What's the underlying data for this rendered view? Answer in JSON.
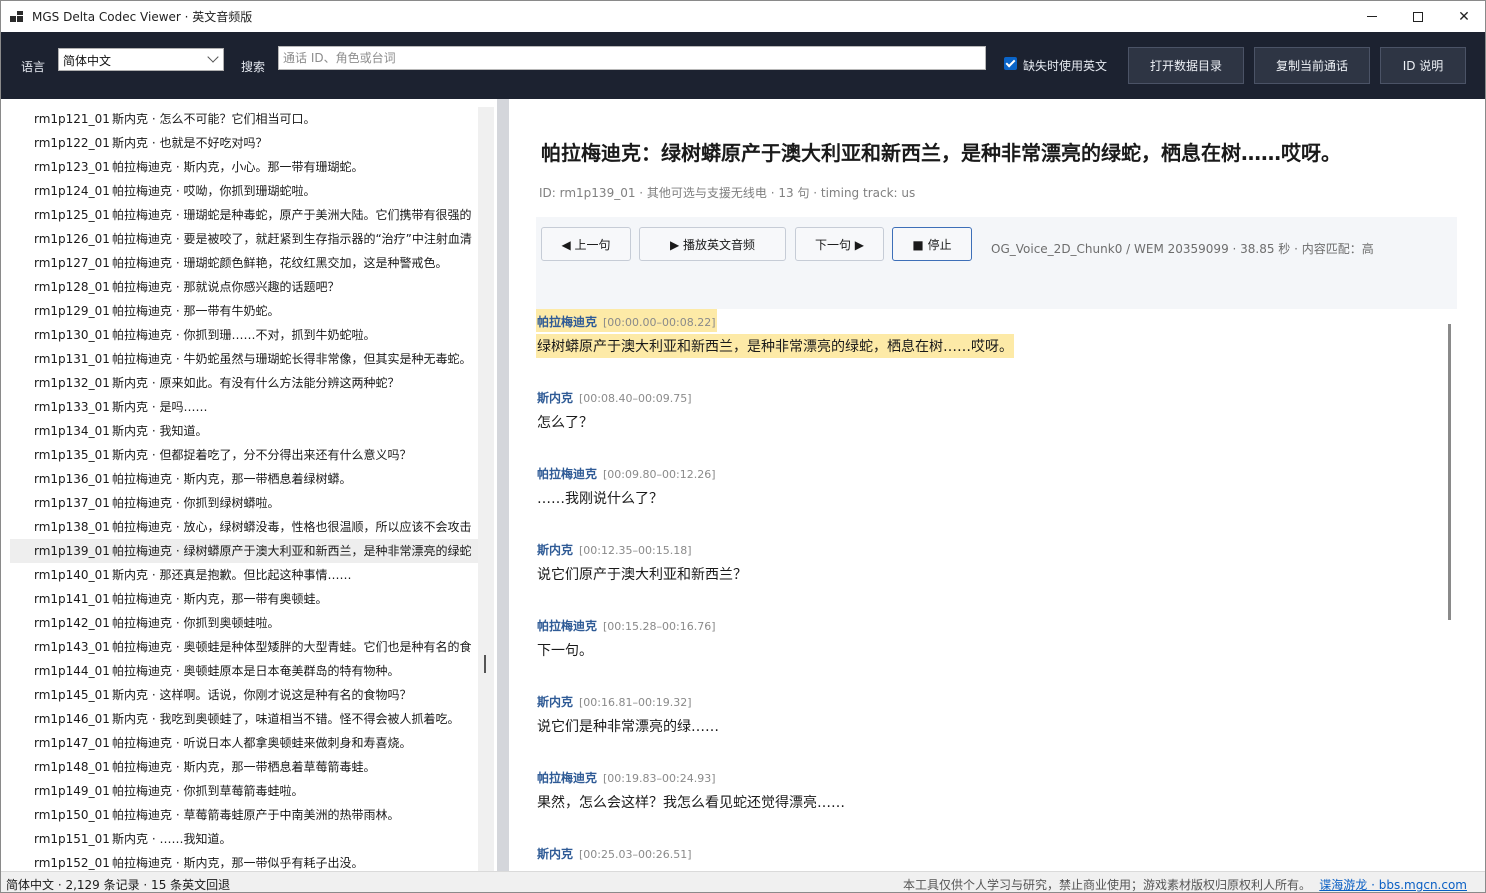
{
  "window": {
    "title": "MGS Delta Codec Viewer · 英文音频版"
  },
  "toolbar": {
    "language_label": "语言",
    "language_value": "简体中文",
    "search_label": "搜索",
    "search_placeholder": "通话 ID、角色或台词",
    "search_value": "",
    "fallback_checked": true,
    "fallback_label": "缺失时使用英文",
    "open_data_label": "打开数据目录",
    "copy_call_label": "复制当前通话",
    "id_help_label": "ID 说明"
  },
  "call_list": {
    "selected_index": 18,
    "items": [
      {
        "id": "rm1p121_01",
        "text": "斯内克 · 怎么不可能？它们相当可口。"
      },
      {
        "id": "rm1p122_01",
        "text": "斯内克 · 也就是不好吃对吗？"
      },
      {
        "id": "rm1p123_01",
        "text": "帕拉梅迪克 · 斯内克，小心。那一带有珊瑚蛇。"
      },
      {
        "id": "rm1p124_01",
        "text": "帕拉梅迪克 · 哎呦，你抓到珊瑚蛇啦。"
      },
      {
        "id": "rm1p125_01",
        "text": "帕拉梅迪克 · 珊瑚蛇是种毒蛇，原产于美洲大陆。它们携带有很强的"
      },
      {
        "id": "rm1p126_01",
        "text": "帕拉梅迪克 · 要是被咬了，就赶紧到生存指示器的“治疗”中注射血清"
      },
      {
        "id": "rm1p127_01",
        "text": "帕拉梅迪克 · 珊瑚蛇颜色鲜艳，花纹红黑交加，这是种警戒色。"
      },
      {
        "id": "rm1p128_01",
        "text": "帕拉梅迪克 · 那就说点你感兴趣的话题吧？"
      },
      {
        "id": "rm1p129_01",
        "text": "帕拉梅迪克 · 那一带有牛奶蛇。"
      },
      {
        "id": "rm1p130_01",
        "text": "帕拉梅迪克 · 你抓到珊……不对，抓到牛奶蛇啦。"
      },
      {
        "id": "rm1p131_01",
        "text": "帕拉梅迪克 · 牛奶蛇虽然与珊瑚蛇长得非常像，但其实是种无毒蛇。"
      },
      {
        "id": "rm1p132_01",
        "text": "斯内克 · 原来如此。有没有什么方法能分辨这两种蛇？"
      },
      {
        "id": "rm1p133_01",
        "text": "斯内克 · 是吗……"
      },
      {
        "id": "rm1p134_01",
        "text": "斯内克 · 我知道。"
      },
      {
        "id": "rm1p135_01",
        "text": "斯内克 · 但都捉着吃了，分不分得出来还有什么意义吗？"
      },
      {
        "id": "rm1p136_01",
        "text": "帕拉梅迪克 · 斯内克，那一带栖息着绿树蟒。"
      },
      {
        "id": "rm1p137_01",
        "text": "帕拉梅迪克 · 你抓到绿树蟒啦。"
      },
      {
        "id": "rm1p138_01",
        "text": "帕拉梅迪克 · 放心，绿树蟒没毒，性格也很温顺，所以应该不会攻击"
      },
      {
        "id": "rm1p139_01",
        "text": "帕拉梅迪克 · 绿树蟒原产于澳大利亚和新西兰，是种非常漂亮的绿蛇"
      },
      {
        "id": "rm1p140_01",
        "text": "斯内克 · 那还真是抱歉。但比起这种事情……"
      },
      {
        "id": "rm1p141_01",
        "text": "帕拉梅迪克 · 斯内克，那一带有奥顿蛙。"
      },
      {
        "id": "rm1p142_01",
        "text": "帕拉梅迪克 · 你抓到奥顿蛙啦。"
      },
      {
        "id": "rm1p143_01",
        "text": "帕拉梅迪克 · 奥顿蛙是种体型矮胖的大型青蛙。它们也是种有名的食"
      },
      {
        "id": "rm1p144_01",
        "text": "帕拉梅迪克 · 奥顿蛙原本是日本奄美群岛的特有物种。"
      },
      {
        "id": "rm1p145_01",
        "text": "斯内克 · 这样啊。话说，你刚才说这是种有名的食物吗？"
      },
      {
        "id": "rm1p146_01",
        "text": "斯内克 · 我吃到奥顿蛙了，味道相当不错。怪不得会被人抓着吃。"
      },
      {
        "id": "rm1p147_01",
        "text": "帕拉梅迪克 · 听说日本人都拿奥顿蛙来做刺身和寿喜烧。"
      },
      {
        "id": "rm1p148_01",
        "text": "帕拉梅迪克 · 斯内克，那一带栖息着草莓箭毒蛙。"
      },
      {
        "id": "rm1p149_01",
        "text": "帕拉梅迪克 · 你抓到草莓箭毒蛙啦。"
      },
      {
        "id": "rm1p150_01",
        "text": "帕拉梅迪克 · 草莓箭毒蛙原产于中南美洲的热带雨林。"
      },
      {
        "id": "rm1p151_01",
        "text": "斯内克 · ……我知道。"
      },
      {
        "id": "rm1p152_01",
        "text": "帕拉梅迪克 · 斯内克，那一带似乎有耗子出没。"
      }
    ]
  },
  "detail": {
    "title": "帕拉梅迪克：绿树蟒原产于澳大利亚和新西兰，是种非常漂亮的绿蛇，栖息在树……哎呀。",
    "meta": "ID: rm1p139_01  ·  其他可选与支援无线电  ·  13 句  ·  timing track: us",
    "controls": {
      "prev_label": "◀ 上一句",
      "play_label": "▶ 播放英文音频",
      "next_label": "下一句 ▶",
      "stop_label": "■ 停止"
    },
    "audio_info": "OG_Voice_2D_Chunk0 / WEM 20359099 · 38.85 秒 · 内容匹配：高",
    "active_line_index": 0,
    "lines": [
      {
        "speaker": "帕拉梅迪克",
        "ts": "[00:00.00–00:08.22]",
        "text": "绿树蟒原产于澳大利亚和新西兰，是种非常漂亮的绿蛇，栖息在树……哎呀。"
      },
      {
        "speaker": "斯内克",
        "ts": "[00:08.40–00:09.75]",
        "text": "怎么了？"
      },
      {
        "speaker": "帕拉梅迪克",
        "ts": "[00:09.80–00:12.26]",
        "text": "……我刚说什么了？"
      },
      {
        "speaker": "斯内克",
        "ts": "[00:12.35–00:15.18]",
        "text": "说它们原产于澳大利亚和新西兰？"
      },
      {
        "speaker": "帕拉梅迪克",
        "ts": "[00:15.28–00:16.76]",
        "text": "下一句。"
      },
      {
        "speaker": "斯内克",
        "ts": "[00:16.81–00:19.32]",
        "text": "说它们是种非常漂亮的绿……"
      },
      {
        "speaker": "帕拉梅迪克",
        "ts": "[00:19.83–00:24.93]",
        "text": "果然，怎么会这样？我怎么看见蛇还觉得漂亮……"
      },
      {
        "speaker": "斯内克",
        "ts": "[00:25.03–00:26.51]",
        "text": ""
      }
    ]
  },
  "statusbar": {
    "summary": "简体中文 · 2,129 条记录 · 15 条英文回退",
    "notice": "本工具仅供个人学习与研究，禁止商业使用；游戏素材版权归原权利人所有。",
    "link": "谍海游龙 · bbs.mgcn.com"
  }
}
